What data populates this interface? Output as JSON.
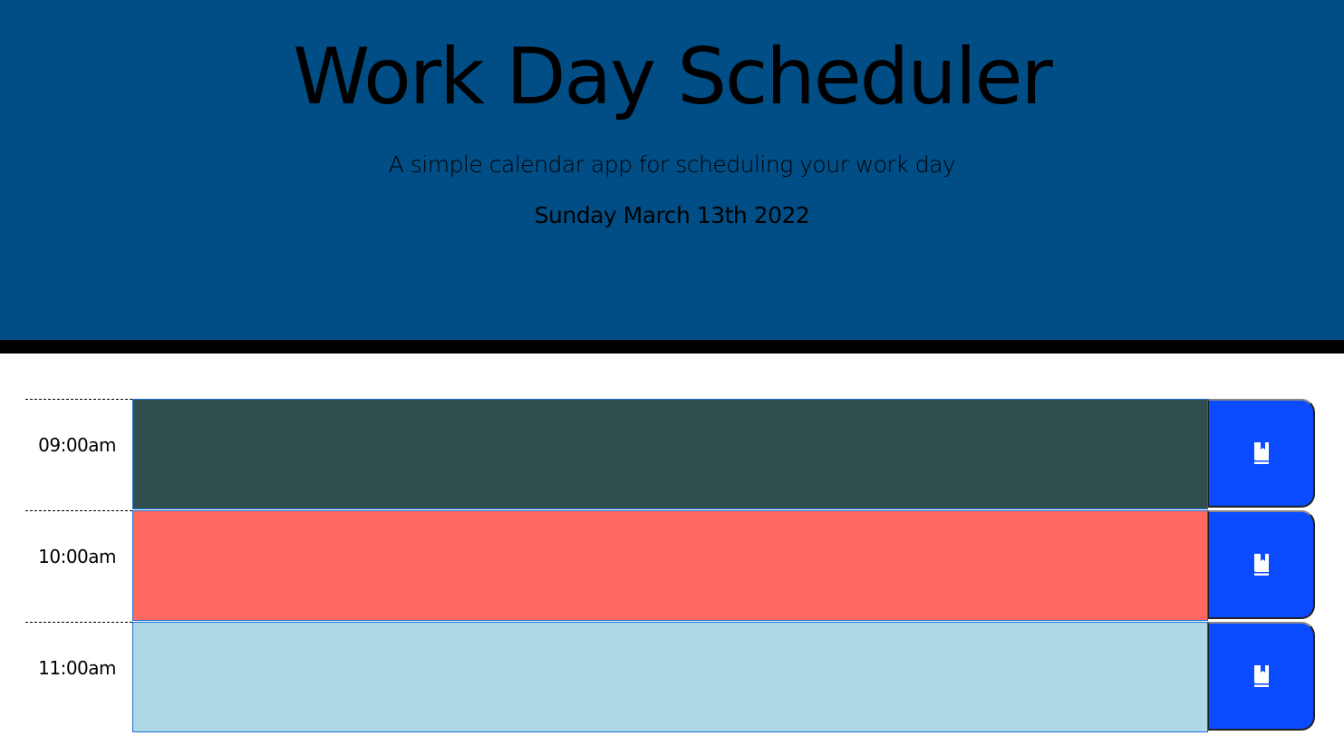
{
  "header": {
    "title": "Work Day Scheduler",
    "lead": "A simple calendar app for scheduling your work day",
    "current_day": "Sunday March 13th 2022",
    "background": "#004e85"
  },
  "time_blocks": [
    {
      "hour": "09:00am",
      "state": "past",
      "description": ""
    },
    {
      "hour": "10:00am",
      "state": "present",
      "description": ""
    },
    {
      "hour": "11:00am",
      "state": "future",
      "description": ""
    }
  ],
  "colors": {
    "past": "#2f4f4f",
    "present": "#ff6961",
    "future": "#add8e6",
    "save_button": "#0b4bff"
  },
  "icons": {
    "save": "book-icon"
  }
}
